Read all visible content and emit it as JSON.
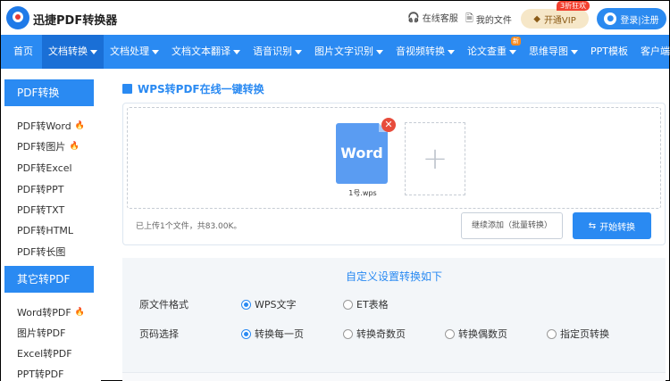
{
  "header": {
    "brand": "迅捷PDF转换器",
    "customer_service": "在线客服",
    "my_files": "我的文件",
    "vip_label": "开通VIP",
    "vip_badge": "3折狂欢",
    "login_label": "登录|注册"
  },
  "nav": {
    "items": [
      {
        "label": "首页",
        "caret": false
      },
      {
        "label": "文档转换",
        "caret": true
      },
      {
        "label": "文档处理",
        "caret": true
      },
      {
        "label": "文档文本翻译",
        "caret": true
      },
      {
        "label": "语音识别",
        "caret": true
      },
      {
        "label": "图片文字识别",
        "caret": true
      },
      {
        "label": "音视频转换",
        "caret": true
      },
      {
        "label": "论文查重",
        "caret": true,
        "badge": "新"
      },
      {
        "label": "思维导图",
        "caret": true
      },
      {
        "label": "PPT模板",
        "caret": false
      },
      {
        "label": "客户端",
        "caret": true
      }
    ]
  },
  "sidebar": {
    "group1_title": "PDF转换",
    "group1_items": [
      "PDF转Word",
      "PDF转图片",
      "PDF转Excel",
      "PDF转PPT",
      "PDF转TXT",
      "PDF转HTML",
      "PDF转长图"
    ],
    "group2_title": "其它转PDF",
    "group2_items": [
      "Word转PDF",
      "图片转PDF",
      "Excel转PDF",
      "PPT转PDF"
    ]
  },
  "main": {
    "title": "WPS转PDF在线一键转换",
    "file_icon_text": "Word",
    "file_name": "1号.wps",
    "upload_status": "已上传1个文件，共83.00K。",
    "continue_label": "继续添加（批量转换）",
    "start_label": "开始转换"
  },
  "settings": {
    "title": "自定义设置转换如下",
    "format_label": "原文件格式",
    "format_options": [
      "WPS文字",
      "ET表格"
    ],
    "page_label": "页码选择",
    "page_options": [
      "转换每一页",
      "转换奇数页",
      "转换偶数页",
      "指定页转换"
    ]
  },
  "colors": {
    "primary": "#2a8af2",
    "nav_active": "#1a6fd6",
    "danger": "#e74c3c",
    "hot": "#f0622d"
  }
}
